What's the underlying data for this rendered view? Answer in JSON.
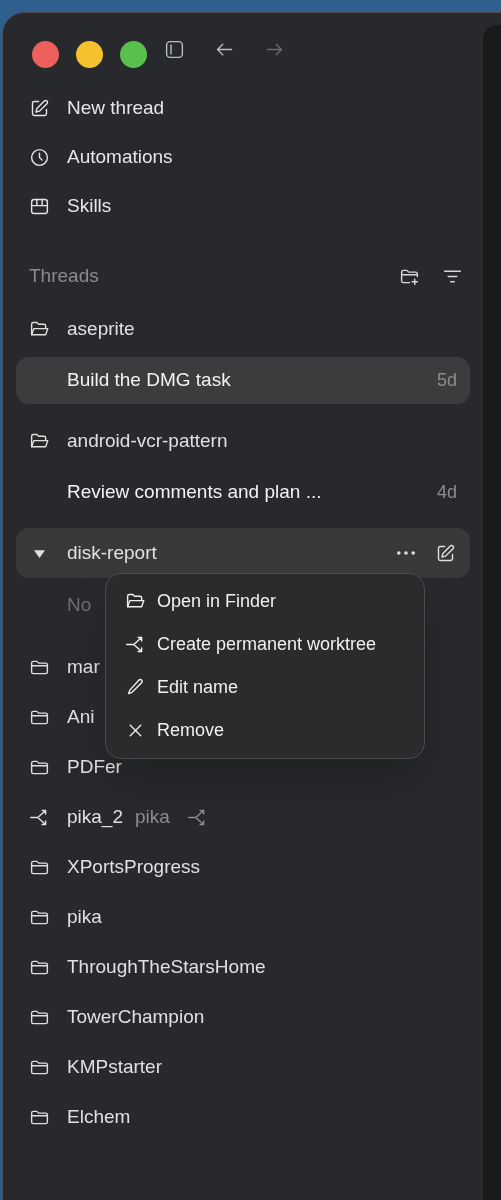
{
  "nav": [
    {
      "label": "New thread"
    },
    {
      "label": "Automations"
    },
    {
      "label": "Skills"
    }
  ],
  "threads_header": {
    "title": "Threads"
  },
  "projects": [
    {
      "kind": "project",
      "name": "aseprite",
      "expanded": true,
      "hovered": false,
      "children": [
        {
          "title": "Build the DMG task",
          "age": "5d",
          "selected": true
        }
      ]
    },
    {
      "kind": "project",
      "name": "android-vcr-pattern",
      "expanded": true,
      "hovered": false,
      "children": [
        {
          "title": "Review comments and plan ...",
          "age": "4d",
          "selected": false
        }
      ]
    },
    {
      "kind": "project",
      "name": "disk-report",
      "expanded": true,
      "hovered": true,
      "empty_text": "No",
      "menu": [
        {
          "label": "Open in Finder"
        },
        {
          "label": "Create permanent worktree"
        },
        {
          "label": "Edit name"
        },
        {
          "label": "Remove"
        }
      ]
    },
    {
      "kind": "project",
      "name": "mar",
      "expanded": false,
      "hovered": false
    },
    {
      "kind": "project",
      "name": "Ani",
      "expanded": false,
      "hovered": false
    },
    {
      "kind": "project",
      "name": "PDFer",
      "expanded": false,
      "hovered": false
    },
    {
      "kind": "worktree",
      "name": "pika_2",
      "branch": "pika",
      "hovered": false
    },
    {
      "kind": "project",
      "name": "XPortsProgress",
      "expanded": false,
      "hovered": false
    },
    {
      "kind": "project",
      "name": "pika",
      "expanded": false,
      "hovered": false
    },
    {
      "kind": "project",
      "name": "ThroughTheStarsHome",
      "expanded": false,
      "hovered": false
    },
    {
      "kind": "project",
      "name": "TowerChampion",
      "expanded": false,
      "hovered": false
    },
    {
      "kind": "project",
      "name": "KMPstarter",
      "expanded": false,
      "hovered": false
    },
    {
      "kind": "project",
      "name": "Elchem",
      "expanded": false,
      "hovered": false
    }
  ]
}
